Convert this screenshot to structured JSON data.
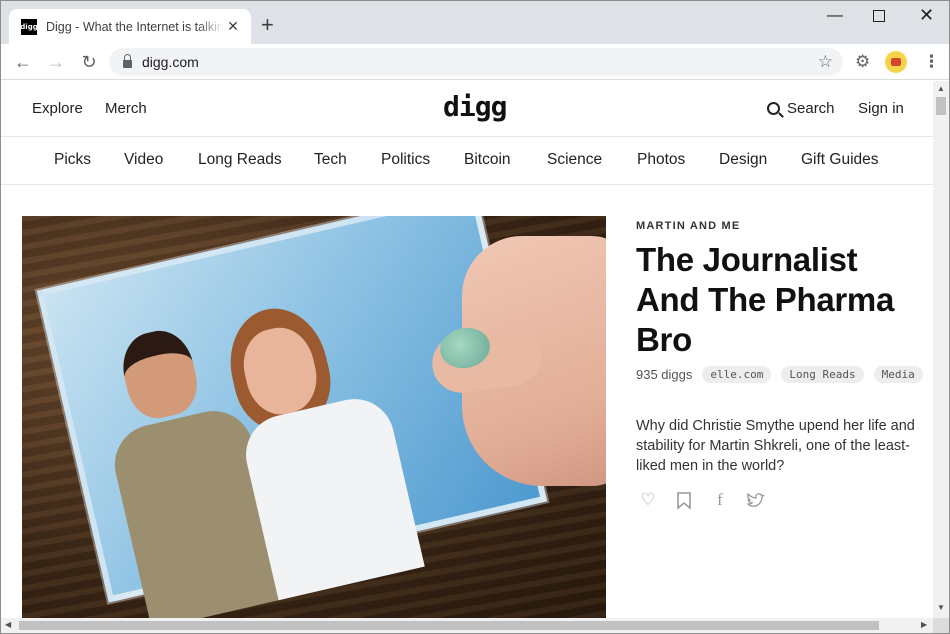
{
  "browser": {
    "tab_title": "Digg - What the Internet is talking about right now",
    "favicon_text": "digg",
    "url": "digg.com",
    "new_tab_label": "+",
    "close_tab_label": "✕"
  },
  "site": {
    "logo": "digg",
    "header_left": [
      "Explore",
      "Merch"
    ],
    "search_label": "Search",
    "signin_label": "Sign in"
  },
  "categories": [
    "Picks",
    "Video",
    "Long Reads",
    "Tech",
    "Politics",
    "Bitcoin",
    "Science",
    "Photos",
    "Design",
    "Gift Guides"
  ],
  "story": {
    "kicker": "MARTIN AND ME",
    "headline": "The Journalist And The Pharma Bro",
    "diggs": "935 diggs",
    "tags": [
      "elle.com",
      "Long Reads",
      "Media"
    ],
    "description": "Why did Christie Smythe upend her life and stability for Martin Shkreli, one of the least-liked men in the world?",
    "actions": [
      "heart-icon",
      "bookmark-icon",
      "facebook-icon",
      "twitter-icon"
    ]
  }
}
